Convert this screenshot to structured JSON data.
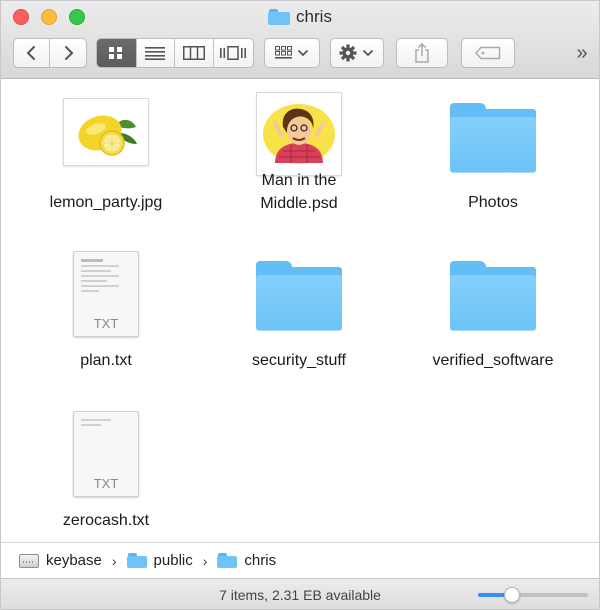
{
  "window": {
    "title": "chris",
    "title_icon": "folder-icon",
    "controls": [
      "close",
      "minimize",
      "zoom"
    ],
    "colors": {
      "close": "#fc605c",
      "minimize": "#fdbc40",
      "zoom": "#34c84a"
    }
  },
  "toolbar": {
    "back_icon": "chevron-left-icon",
    "forward_icon": "chevron-right-icon",
    "view_modes": [
      "icon-view",
      "list-view",
      "column-view",
      "cover-flow-view"
    ],
    "active_view": "icon-view",
    "arrange_icon": "arrange-grid-icon",
    "action_icon": "gear-icon",
    "share_icon": "share-icon",
    "tag_icon": "tag-icon",
    "overflow_label": "»"
  },
  "files": [
    {
      "name": "lemon_party.jpg",
      "kind": "image",
      "icon": "lemon-image-thumbnail"
    },
    {
      "name": "Man in the Middle.psd",
      "name_line1": "Man in the",
      "name_line2": "Middle.psd",
      "kind": "image",
      "icon": "man-illustration-thumbnail"
    },
    {
      "name": "Photos",
      "kind": "folder",
      "icon": "folder-icon"
    },
    {
      "name": "plan.txt",
      "kind": "text",
      "icon": "text-document-icon",
      "ext_label": "TXT"
    },
    {
      "name": "security_stuff",
      "kind": "folder",
      "icon": "folder-icon"
    },
    {
      "name": "verified_software",
      "kind": "folder",
      "icon": "folder-icon"
    },
    {
      "name": "zerocash.txt",
      "kind": "text",
      "icon": "text-document-icon",
      "ext_label": "TXT"
    }
  ],
  "path_bar": [
    {
      "label": "keybase",
      "icon": "hard-drive-icon"
    },
    {
      "label": "public",
      "icon": "folder-icon"
    },
    {
      "label": "chris",
      "icon": "folder-icon"
    }
  ],
  "path_separator": "›",
  "status": {
    "text": "7 items, 2.31 EB available",
    "zoom_level": 0.28
  }
}
